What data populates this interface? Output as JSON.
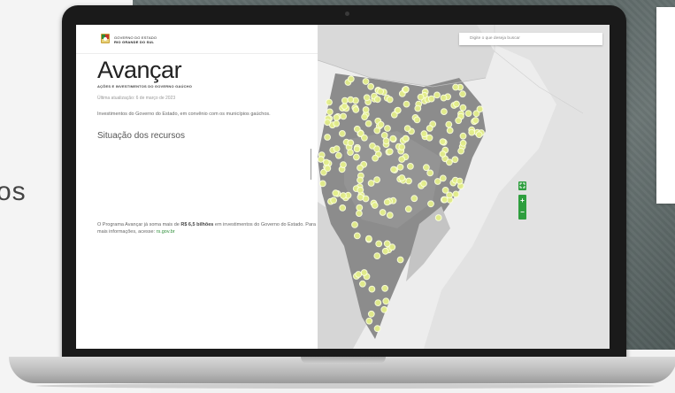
{
  "page": {
    "side_word": "os"
  },
  "header": {
    "gov_line1": "GOVERNO DO ESTADO",
    "gov_line2": "RIO GRANDE DO SUL"
  },
  "main": {
    "title": "Avançar",
    "subtitle": "AÇÕES E INVESTIMENTOS DO GOVERNO GAÚCHO",
    "updated": "Última atualização: 6 de março de 2023",
    "description": "Investimentos do Governo do Estado, em convênio com os municípios gaúchos.",
    "section_title": "Situação dos recursos",
    "note_part1": "O Programa Avançar já soma mais de ",
    "note_bold": "R$ 6,5 bilhões",
    "note_part2": " em investimentos do Governo do Estado. Para mais informações, acesse: ",
    "note_link": "rs.gov.br"
  },
  "map": {
    "search_placeholder": "Digite o que deseja buscar",
    "fullscreen_icon": "fullscreen-icon",
    "zoom_in": "+",
    "zoom_out": "−",
    "marker_color": "#e4ef8a",
    "accent_color": "#2e9e3e"
  }
}
